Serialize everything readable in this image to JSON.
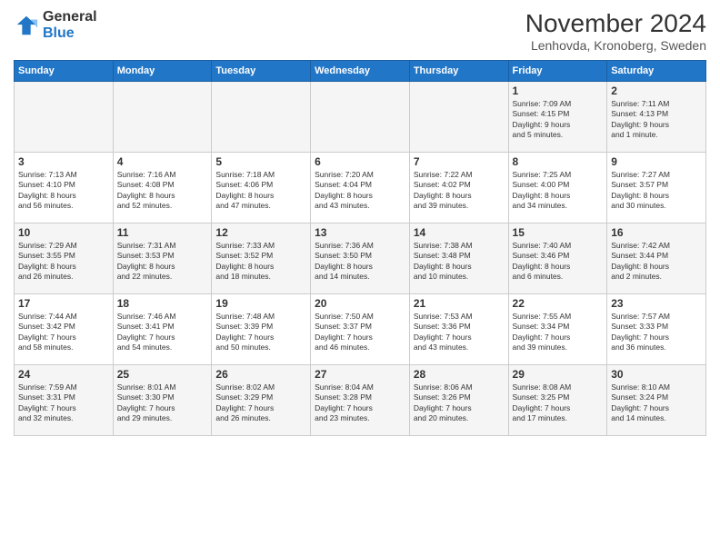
{
  "logo": {
    "general": "General",
    "blue": "Blue"
  },
  "title": "November 2024",
  "location": "Lenhovda, Kronoberg, Sweden",
  "headers": [
    "Sunday",
    "Monday",
    "Tuesday",
    "Wednesday",
    "Thursday",
    "Friday",
    "Saturday"
  ],
  "weeks": [
    [
      {
        "day": "",
        "info": ""
      },
      {
        "day": "",
        "info": ""
      },
      {
        "day": "",
        "info": ""
      },
      {
        "day": "",
        "info": ""
      },
      {
        "day": "",
        "info": ""
      },
      {
        "day": "1",
        "info": "Sunrise: 7:09 AM\nSunset: 4:15 PM\nDaylight: 9 hours\nand 5 minutes."
      },
      {
        "day": "2",
        "info": "Sunrise: 7:11 AM\nSunset: 4:13 PM\nDaylight: 9 hours\nand 1 minute."
      }
    ],
    [
      {
        "day": "3",
        "info": "Sunrise: 7:13 AM\nSunset: 4:10 PM\nDaylight: 8 hours\nand 56 minutes."
      },
      {
        "day": "4",
        "info": "Sunrise: 7:16 AM\nSunset: 4:08 PM\nDaylight: 8 hours\nand 52 minutes."
      },
      {
        "day": "5",
        "info": "Sunrise: 7:18 AM\nSunset: 4:06 PM\nDaylight: 8 hours\nand 47 minutes."
      },
      {
        "day": "6",
        "info": "Sunrise: 7:20 AM\nSunset: 4:04 PM\nDaylight: 8 hours\nand 43 minutes."
      },
      {
        "day": "7",
        "info": "Sunrise: 7:22 AM\nSunset: 4:02 PM\nDaylight: 8 hours\nand 39 minutes."
      },
      {
        "day": "8",
        "info": "Sunrise: 7:25 AM\nSunset: 4:00 PM\nDaylight: 8 hours\nand 34 minutes."
      },
      {
        "day": "9",
        "info": "Sunrise: 7:27 AM\nSunset: 3:57 PM\nDaylight: 8 hours\nand 30 minutes."
      }
    ],
    [
      {
        "day": "10",
        "info": "Sunrise: 7:29 AM\nSunset: 3:55 PM\nDaylight: 8 hours\nand 26 minutes."
      },
      {
        "day": "11",
        "info": "Sunrise: 7:31 AM\nSunset: 3:53 PM\nDaylight: 8 hours\nand 22 minutes."
      },
      {
        "day": "12",
        "info": "Sunrise: 7:33 AM\nSunset: 3:52 PM\nDaylight: 8 hours\nand 18 minutes."
      },
      {
        "day": "13",
        "info": "Sunrise: 7:36 AM\nSunset: 3:50 PM\nDaylight: 8 hours\nand 14 minutes."
      },
      {
        "day": "14",
        "info": "Sunrise: 7:38 AM\nSunset: 3:48 PM\nDaylight: 8 hours\nand 10 minutes."
      },
      {
        "day": "15",
        "info": "Sunrise: 7:40 AM\nSunset: 3:46 PM\nDaylight: 8 hours\nand 6 minutes."
      },
      {
        "day": "16",
        "info": "Sunrise: 7:42 AM\nSunset: 3:44 PM\nDaylight: 8 hours\nand 2 minutes."
      }
    ],
    [
      {
        "day": "17",
        "info": "Sunrise: 7:44 AM\nSunset: 3:42 PM\nDaylight: 7 hours\nand 58 minutes."
      },
      {
        "day": "18",
        "info": "Sunrise: 7:46 AM\nSunset: 3:41 PM\nDaylight: 7 hours\nand 54 minutes."
      },
      {
        "day": "19",
        "info": "Sunrise: 7:48 AM\nSunset: 3:39 PM\nDaylight: 7 hours\nand 50 minutes."
      },
      {
        "day": "20",
        "info": "Sunrise: 7:50 AM\nSunset: 3:37 PM\nDaylight: 7 hours\nand 46 minutes."
      },
      {
        "day": "21",
        "info": "Sunrise: 7:53 AM\nSunset: 3:36 PM\nDaylight: 7 hours\nand 43 minutes."
      },
      {
        "day": "22",
        "info": "Sunrise: 7:55 AM\nSunset: 3:34 PM\nDaylight: 7 hours\nand 39 minutes."
      },
      {
        "day": "23",
        "info": "Sunrise: 7:57 AM\nSunset: 3:33 PM\nDaylight: 7 hours\nand 36 minutes."
      }
    ],
    [
      {
        "day": "24",
        "info": "Sunrise: 7:59 AM\nSunset: 3:31 PM\nDaylight: 7 hours\nand 32 minutes."
      },
      {
        "day": "25",
        "info": "Sunrise: 8:01 AM\nSunset: 3:30 PM\nDaylight: 7 hours\nand 29 minutes."
      },
      {
        "day": "26",
        "info": "Sunrise: 8:02 AM\nSunset: 3:29 PM\nDaylight: 7 hours\nand 26 minutes."
      },
      {
        "day": "27",
        "info": "Sunrise: 8:04 AM\nSunset: 3:28 PM\nDaylight: 7 hours\nand 23 minutes."
      },
      {
        "day": "28",
        "info": "Sunrise: 8:06 AM\nSunset: 3:26 PM\nDaylight: 7 hours\nand 20 minutes."
      },
      {
        "day": "29",
        "info": "Sunrise: 8:08 AM\nSunset: 3:25 PM\nDaylight: 7 hours\nand 17 minutes."
      },
      {
        "day": "30",
        "info": "Sunrise: 8:10 AM\nSunset: 3:24 PM\nDaylight: 7 hours\nand 14 minutes."
      }
    ]
  ]
}
